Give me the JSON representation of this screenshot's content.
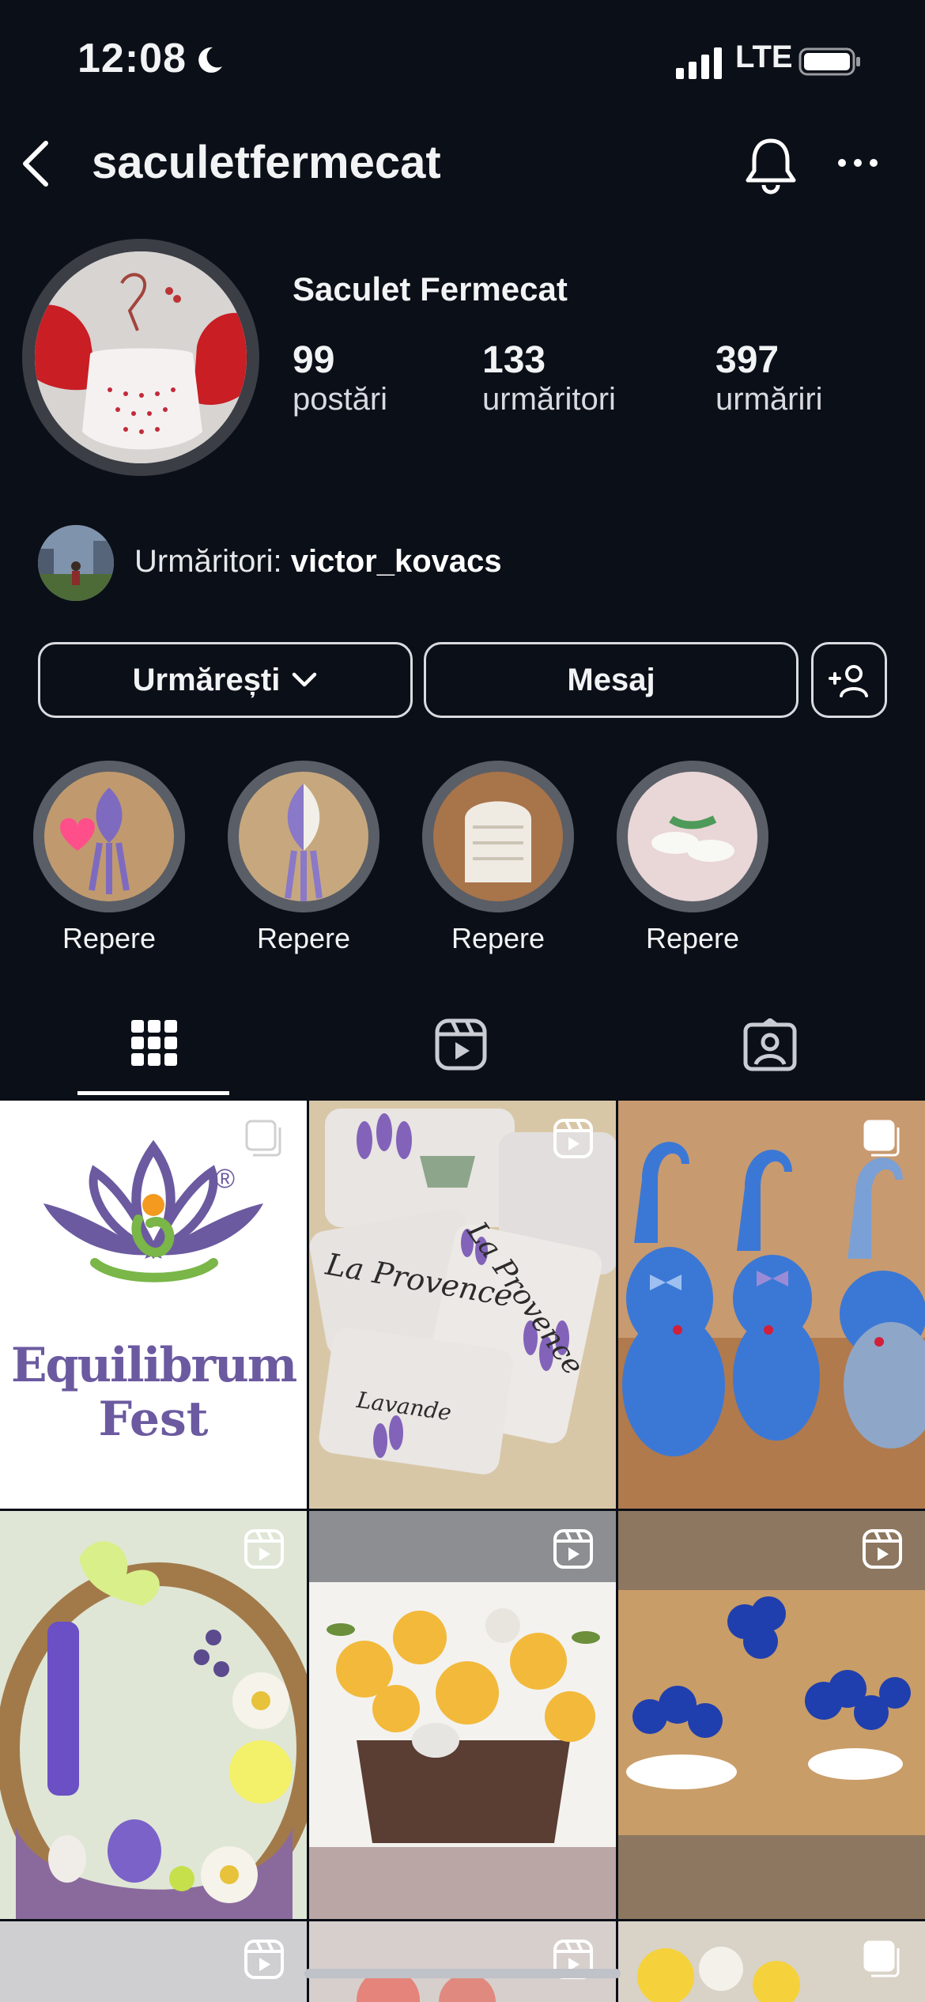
{
  "status_bar": {
    "time": "12:08",
    "network": "LTE"
  },
  "header": {
    "username": "saculetfermecat"
  },
  "profile": {
    "display_name": "Saculet Fermecat",
    "stats": [
      {
        "value": "99",
        "label": "postări"
      },
      {
        "value": "133",
        "label": "urmăritori"
      },
      {
        "value": "397",
        "label": "urmăriri"
      }
    ],
    "followed_by_prefix": "Urmăritori: ",
    "followed_by_user": "victor_kovacs"
  },
  "buttons": {
    "following": "Urmărești",
    "message": "Mesaj"
  },
  "highlights": [
    {
      "label": "Repere"
    },
    {
      "label": "Repere"
    },
    {
      "label": "Repere"
    },
    {
      "label": "Repere"
    }
  ],
  "posts": {
    "logo_brand_line1": "Equilibrum",
    "logo_brand_line2": "Fest",
    "logo_mark": "®",
    "pillow_text": "La Provence",
    "pillow_text_2": "Lavande"
  },
  "colors": {
    "background": "#0b0f17",
    "accent_purple": "#6b5aa0",
    "accent_green": "#7ab648",
    "accent_orange": "#f39a1f"
  }
}
